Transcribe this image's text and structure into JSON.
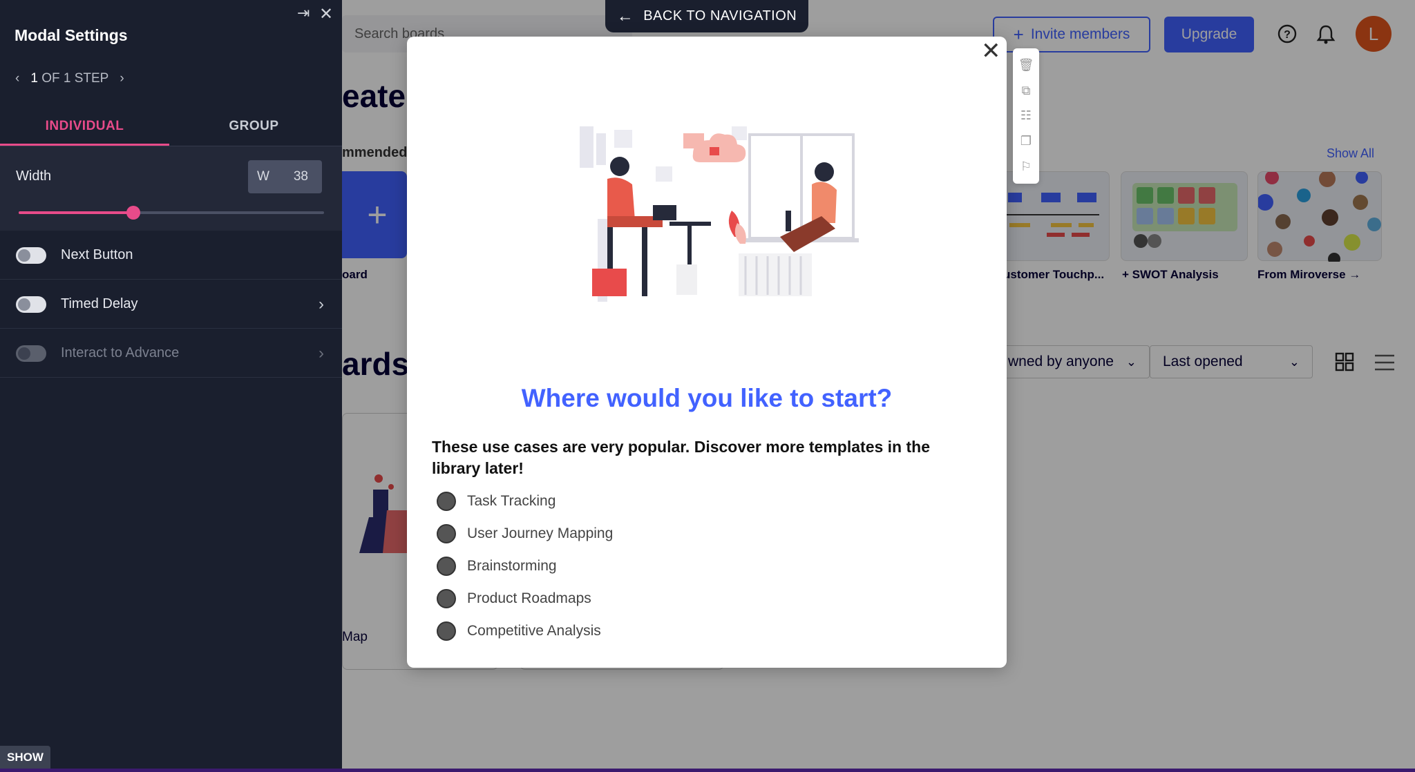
{
  "background_app": {
    "search_placeholder": "Search boards",
    "invite_label": "Invite members",
    "upgrade_label": "Upgrade",
    "avatar_letter": "L",
    "create_heading": "eate",
    "recommended_label": "mmended",
    "show_all": "Show All",
    "new_board_label": "oard",
    "templates": [
      {
        "label": "ustomer Touchp..."
      },
      {
        "label": "+ SWOT Analysis"
      },
      {
        "label": "From Miroverse →"
      }
    ],
    "boards_heading": "ards",
    "owner_filter": "wned by anyone",
    "sort_filter": "Last opened",
    "board_card_label": "Map"
  },
  "back_nav": {
    "label": "BACK TO NAVIGATION"
  },
  "panel": {
    "title": "Modal Settings",
    "step_number": "1",
    "step_text": "OF 1 STEP",
    "tabs": [
      {
        "label": "INDIVIDUAL",
        "active": true
      },
      {
        "label": "GROUP",
        "active": false
      }
    ],
    "width_label": "Width",
    "width_prefix": "W",
    "width_value": "38",
    "toggles": [
      {
        "label": "Next Button",
        "enabled": true
      },
      {
        "label": "Timed Delay",
        "enabled": true
      },
      {
        "label": "Interact to Advance",
        "enabled": false
      }
    ],
    "show_label": "SHOW"
  },
  "modal": {
    "heading": "Where would you like to start?",
    "description": "These use cases are very popular. Discover more templates in the library later!",
    "options": [
      {
        "label": "Task Tracking"
      },
      {
        "label": "User Journey Mapping"
      },
      {
        "label": "Brainstorming"
      },
      {
        "label": "Product Roadmaps"
      },
      {
        "label": "Competitive Analysis"
      }
    ]
  },
  "colors": {
    "accent_blue": "#4262ff",
    "accent_pink": "#e84b8a",
    "panel_bg": "#1a1f2e"
  }
}
